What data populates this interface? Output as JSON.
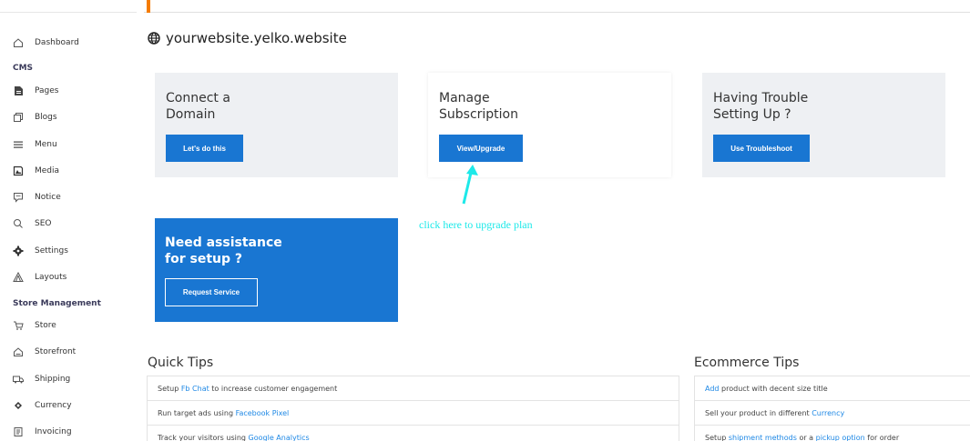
{
  "sidebar": {
    "items": [
      {
        "label": "Dashboard",
        "icon": "home-icon"
      },
      {
        "label": "Pages",
        "icon": "page-icon"
      },
      {
        "label": "Blogs",
        "icon": "blog-icon"
      },
      {
        "label": "Menu",
        "icon": "menu-icon"
      },
      {
        "label": "Media",
        "icon": "media-icon"
      },
      {
        "label": "Notice",
        "icon": "notice-icon"
      },
      {
        "label": "SEO",
        "icon": "search-icon"
      },
      {
        "label": "Settings",
        "icon": "gear-icon"
      },
      {
        "label": "Layouts",
        "icon": "layouts-icon"
      },
      {
        "label": "Store",
        "icon": "store-icon"
      },
      {
        "label": "Storefront",
        "icon": "storefront-icon"
      },
      {
        "label": "Shipping",
        "icon": "shipping-icon"
      },
      {
        "label": "Currency",
        "icon": "currency-icon"
      },
      {
        "label": "Invoicing",
        "icon": "invoice-icon"
      }
    ],
    "headings": [
      "CMS",
      "Store Management"
    ]
  },
  "site": {
    "title": "yourwebsite.yelko.website",
    "icon": "globe-icon"
  },
  "cards": [
    {
      "title": "Connect a\nDomain",
      "button": "Let's do this"
    },
    {
      "title": "Manage\nSubscription",
      "button": "View/Upgrade"
    },
    {
      "title": "Having Trouble\nSetting Up ?",
      "button": "Use Troubleshoot"
    }
  ],
  "assist": {
    "title": "Need assistance\nfor setup ?",
    "button": "Request Service"
  },
  "annotation": {
    "text": "click here to upgrade plan",
    "color": "#1de9e9"
  },
  "quick_tips": {
    "title": "Quick Tips",
    "rows": [
      {
        "pre": "Setup ",
        "link": "Fb Chat",
        "post": " to increase customer engagement"
      },
      {
        "pre": "Run target ads using ",
        "link": "Facebook Pixel",
        "post": ""
      },
      {
        "pre": "Track your visitors using ",
        "link": "Google Analytics",
        "post": ""
      }
    ]
  },
  "ecommerce_tips": {
    "title": "Ecommerce Tips",
    "rows": [
      {
        "pre": "",
        "link": "Add",
        "post": " product with decent size title"
      },
      {
        "pre": "Sell your product in different ",
        "link": "Currency",
        "post": ""
      },
      {
        "pre": "Setup ",
        "link": "shipment methods",
        "mid": " or a ",
        "link2": "pickup option",
        "post": " for order"
      }
    ]
  },
  "colors": {
    "primary": "#1976d2",
    "accent": "#f57c00",
    "link": "#1e88e5"
  }
}
